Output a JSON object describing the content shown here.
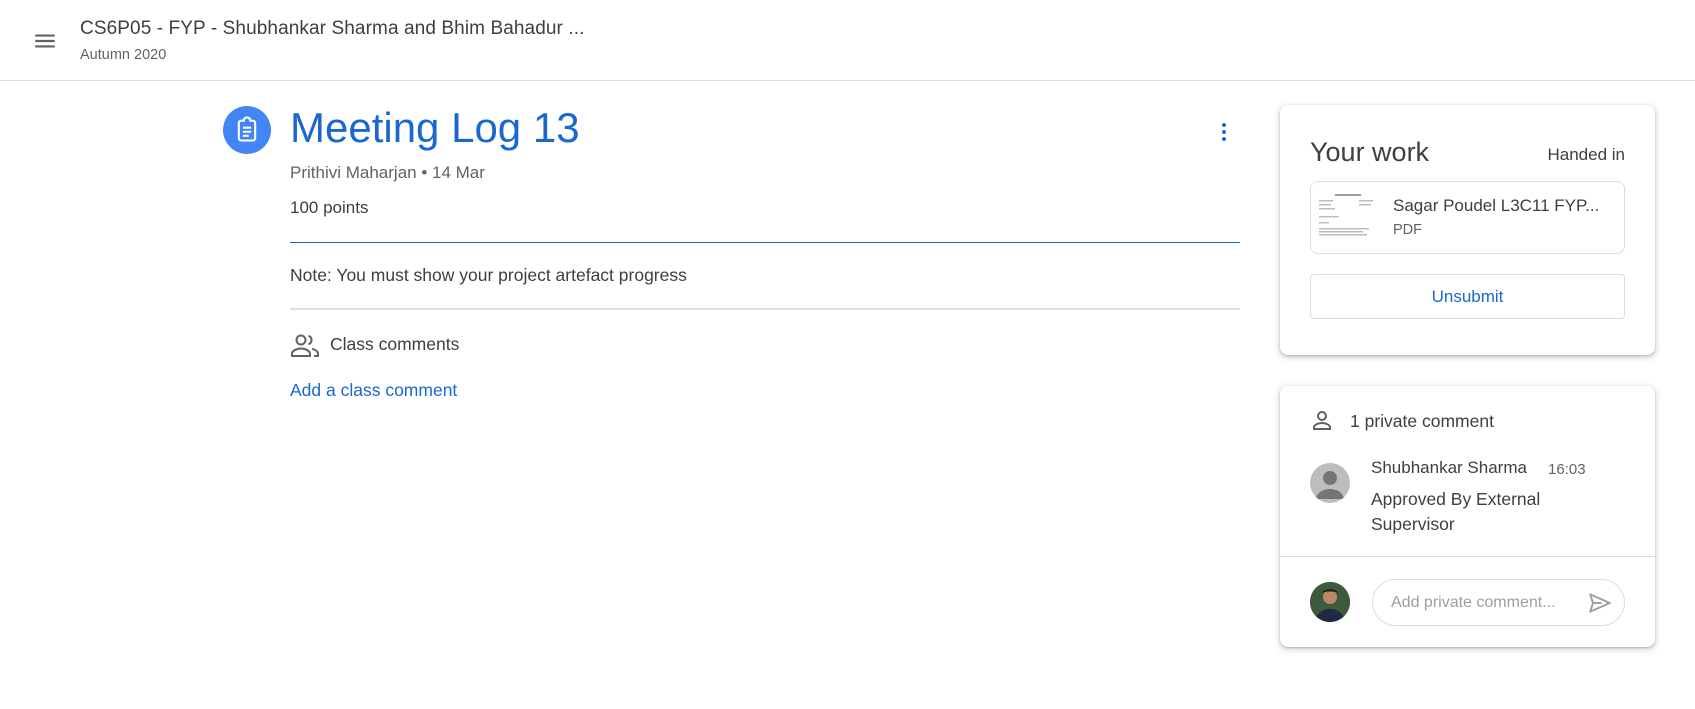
{
  "header": {
    "menu_icon": "hamburger-menu-icon",
    "class_title": "CS6P05 - FYP - Shubhankar Sharma and Bhim Bahadur ...",
    "class_subtitle": "Autumn 2020"
  },
  "assignment": {
    "icon": "assignment-clipboard-icon",
    "title": "Meeting Log 13",
    "meta": "Prithivi Maharjan • 14 Mar",
    "points": "100 points",
    "note": "Note: You must show your project artefact progress",
    "more_icon": "more-vert-icon",
    "class_comments_icon": "people-icon",
    "class_comments_label": "Class comments",
    "add_class_comment": "Add a class comment",
    "accent_color": "#1967d2",
    "icon_color": "#4285f4"
  },
  "your_work": {
    "title": "Your work",
    "status": "Handed in",
    "attachment": {
      "name": "Sagar Poudel L3C11 FYP...",
      "type": "PDF"
    },
    "unsubmit_label": "Unsubmit"
  },
  "private_comments": {
    "icon": "person-icon",
    "label": "1 private comment",
    "comments": [
      {
        "author": "Shubhankar Sharma",
        "time": "16:03",
        "text": "Approved By External Supervisor"
      }
    ],
    "input_placeholder": "Add private comment...",
    "send_icon": "send-icon"
  }
}
